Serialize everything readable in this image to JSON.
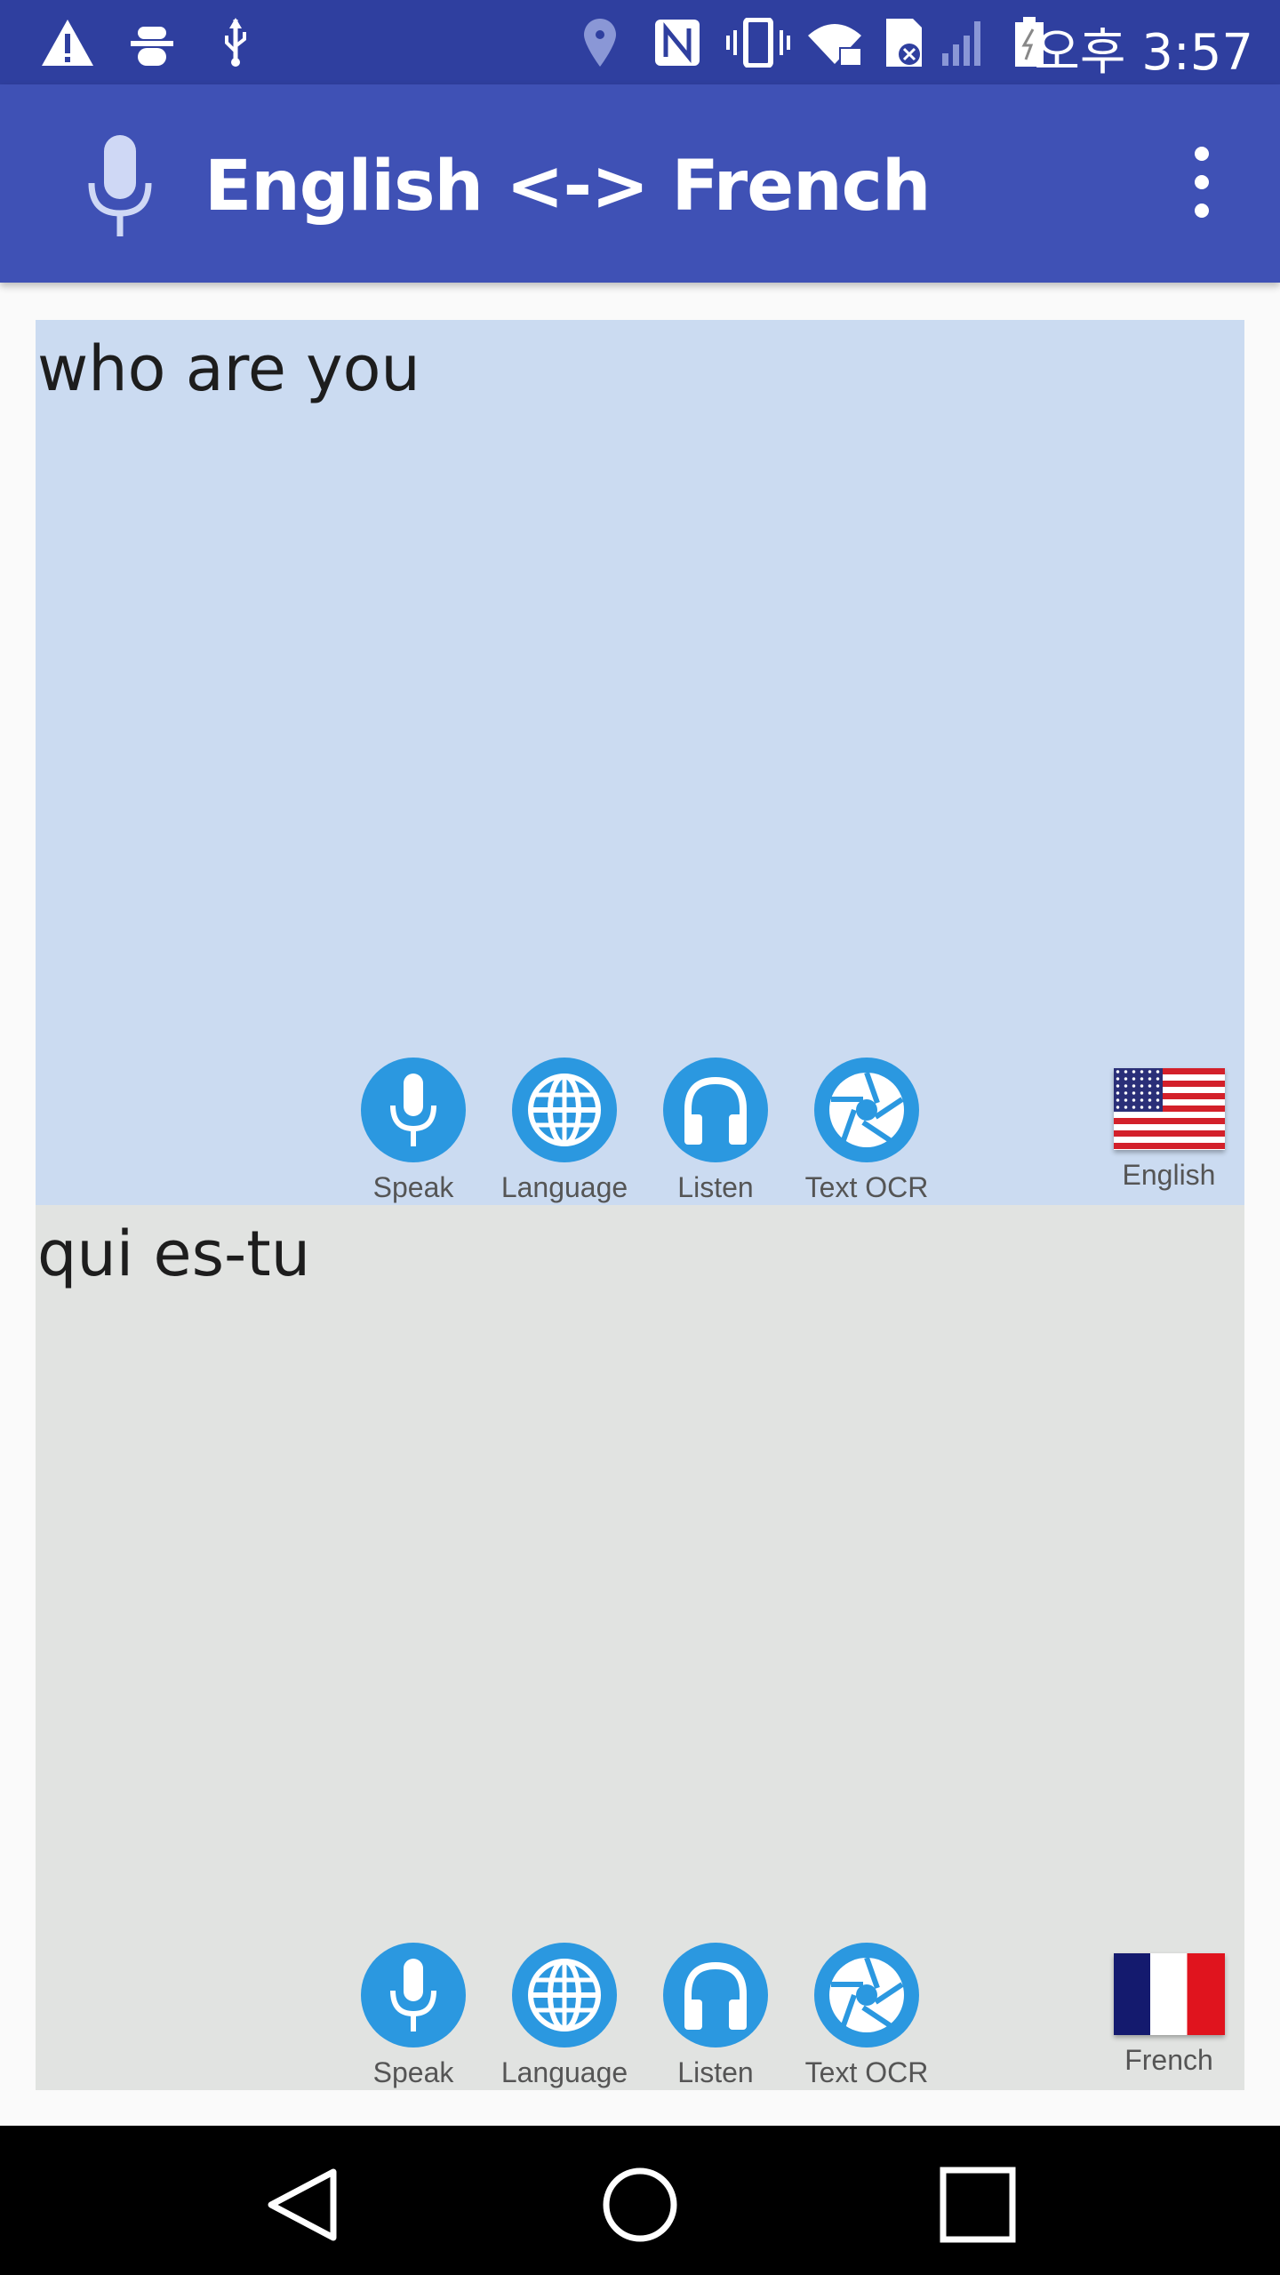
{
  "status_bar": {
    "time": "오후 3:57",
    "icons": [
      "warning-icon",
      "android-debug-icon",
      "usb-icon",
      "location-icon",
      "nfc-icon",
      "vibrate-icon",
      "wifi-lock-icon",
      "sd-card-error-icon",
      "signal-icon",
      "battery-charging-icon"
    ]
  },
  "app_bar": {
    "title": "English <-> French",
    "icon": "mic-icon",
    "menu_icon": "more-vert-icon",
    "color": "#3F51B5"
  },
  "source": {
    "text": "who are you",
    "background": "#CBDBF1",
    "buttons": [
      {
        "label": "Speak",
        "icon": "mic-icon"
      },
      {
        "label": "Language",
        "icon": "globe-icon"
      },
      {
        "label": "Listen",
        "icon": "headphones-icon"
      },
      {
        "label": "Text OCR",
        "icon": "camera-aperture-icon"
      }
    ],
    "language": "English",
    "flag": "us-flag"
  },
  "target": {
    "text": "qui es-tu",
    "background": "#E1E3E1",
    "buttons": [
      {
        "label": "Speak",
        "icon": "mic-icon"
      },
      {
        "label": "Language",
        "icon": "globe-icon"
      },
      {
        "label": "Listen",
        "icon": "headphones-icon"
      },
      {
        "label": "Text OCR",
        "icon": "camera-aperture-icon"
      }
    ],
    "language": "French",
    "flag": "france-flag"
  },
  "nav_bar": {
    "buttons": [
      "back-icon",
      "home-icon",
      "recents-icon"
    ]
  },
  "accent": "#2B98E0"
}
